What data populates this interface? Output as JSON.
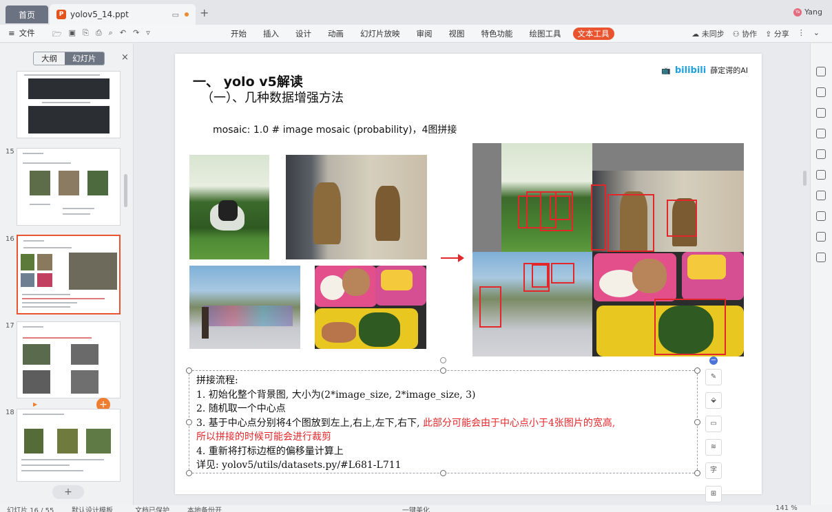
{
  "window": {
    "home_tab": "首页",
    "doc_tab": "yolov5_14.ppt",
    "user_name": "Yang",
    "user_avatar_text": "Ya"
  },
  "menubar": {
    "file_label": "文件",
    "items": [
      "开始",
      "插入",
      "设计",
      "动画",
      "幻灯片放映",
      "审阅",
      "视图",
      "特色功能",
      "绘图工具",
      "文本工具"
    ],
    "active_index": 9,
    "right": [
      "未同步",
      "协作",
      "分享"
    ]
  },
  "left_panel": {
    "tab_outline": "大纲",
    "tab_slides": "幻灯片",
    "slide_numbers": [
      "15",
      "16",
      "17",
      "18"
    ],
    "selected_slide": "16"
  },
  "slide": {
    "title1": "一、 yolo v5解读",
    "title2": "（一）、几种数据增强方法",
    "logo_brand": "bilibili",
    "logo_text": "薛定谔的AI",
    "mosaic_line": "mosaic: 1.0  # image mosaic (probability)，4图拼接",
    "text_lines": {
      "l1": "拼接流程:",
      "l2": "1. 初始化整个背景图, 大小为(2*image_size, 2*image_size, 3)",
      "l3": "2. 随机取一个中心点",
      "l4a": "3. 基于中心点分别将4个图放到左上,右上,左下,右下, ",
      "l4b": "此部分可能会由于中心点小于4张图片的宽高,",
      "l5": "所以拼接的时候可能会进行裁剪",
      "l6": "4. 重新将打标边框的偏移量计算上",
      "l7": "详见: yolov5/utils/datasets.py/#L681-L711"
    }
  },
  "statusbar": {
    "slide_info": "幻灯片 16 / 55",
    "template": "默认设计模板",
    "protect": "文档已保护",
    "backup": "本地备份开",
    "beautify": "一键美化",
    "zoom": "141 %"
  },
  "colors": {
    "accent": "#e9542f",
    "box_red": "#e3262a",
    "bili_blue": "#1fa1e1"
  }
}
